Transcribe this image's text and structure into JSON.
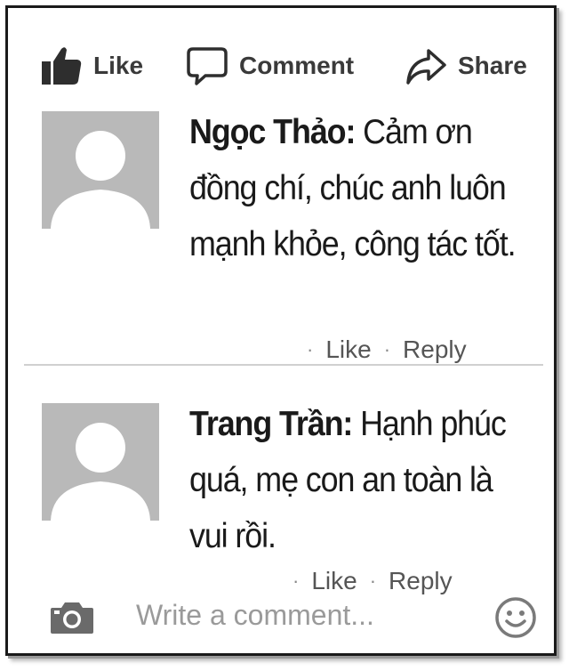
{
  "actions": {
    "like": {
      "label": "Like",
      "icon": "thumbs-up-icon"
    },
    "comment": {
      "label": "Comment",
      "icon": "speech-bubble-icon"
    },
    "share": {
      "label": "Share",
      "icon": "share-arrow-icon"
    }
  },
  "comments": [
    {
      "author": "Ngọc Thảo:",
      "text": "Cảm ơn đồng chí, chúc anh luôn mạnh khỏe, công tác tốt.",
      "like_label": "Like",
      "reply_label": "Reply",
      "separator": "·"
    },
    {
      "author": "Trang Trần:",
      "text": "Hạnh phúc quá, mẹ con an toàn là vui rồi.",
      "like_label": "Like",
      "reply_label": "Reply",
      "separator": "·"
    }
  ],
  "composer": {
    "placeholder": "Write a comment...",
    "camera_icon": "camera-icon",
    "emoji_icon": "smiley-icon"
  },
  "colors": {
    "icon_gray": "#3a3a3a",
    "avatar_bg": "#b9b9b9",
    "avatar_fg": "#ffffff"
  }
}
